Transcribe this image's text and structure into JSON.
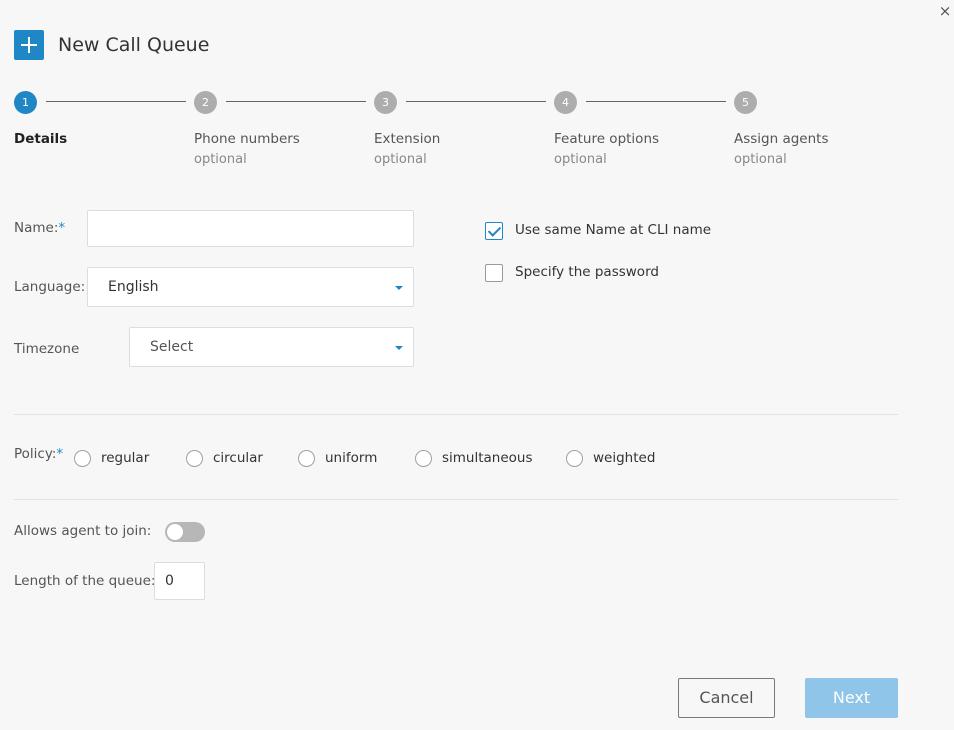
{
  "dialog": {
    "title": "New Call Queue",
    "close_symbol": "×"
  },
  "steps": [
    {
      "num": "1",
      "label": "Details",
      "sub": "",
      "active": true
    },
    {
      "num": "2",
      "label": "Phone numbers",
      "sub": "optional",
      "active": false
    },
    {
      "num": "3",
      "label": "Extension",
      "sub": "optional",
      "active": false
    },
    {
      "num": "4",
      "label": "Feature options",
      "sub": "optional",
      "active": false
    },
    {
      "num": "5",
      "label": "Assign agents",
      "sub": "optional",
      "active": false
    }
  ],
  "form": {
    "name_label": "Name:",
    "required_mark": "*",
    "name_value": "",
    "language_label": "Language:",
    "language_value": "English",
    "timezone_label": "Timezone",
    "timezone_value": "Select",
    "use_same_name_label": "Use same Name at CLI name",
    "use_same_name_checked": true,
    "specify_password_label": "Specify the password",
    "specify_password_checked": false,
    "policy_label": "Policy:",
    "policy_options": [
      "regular",
      "circular",
      "uniform",
      "simultaneous",
      "weighted"
    ],
    "allows_agent_label": "Allows agent to join:",
    "allows_agent_on": false,
    "queue_length_label": "Length of the queue:",
    "queue_length_value": "0"
  },
  "buttons": {
    "cancel": "Cancel",
    "next": "Next"
  },
  "colors": {
    "accent": "#1f87c6",
    "next_disabled": "#8ec5e8",
    "inactive_step": "#adadad"
  },
  "icons": {
    "header": "plus-icon",
    "close": "close-icon",
    "dropdown": "caret-down-icon",
    "check": "checkmark-icon"
  }
}
